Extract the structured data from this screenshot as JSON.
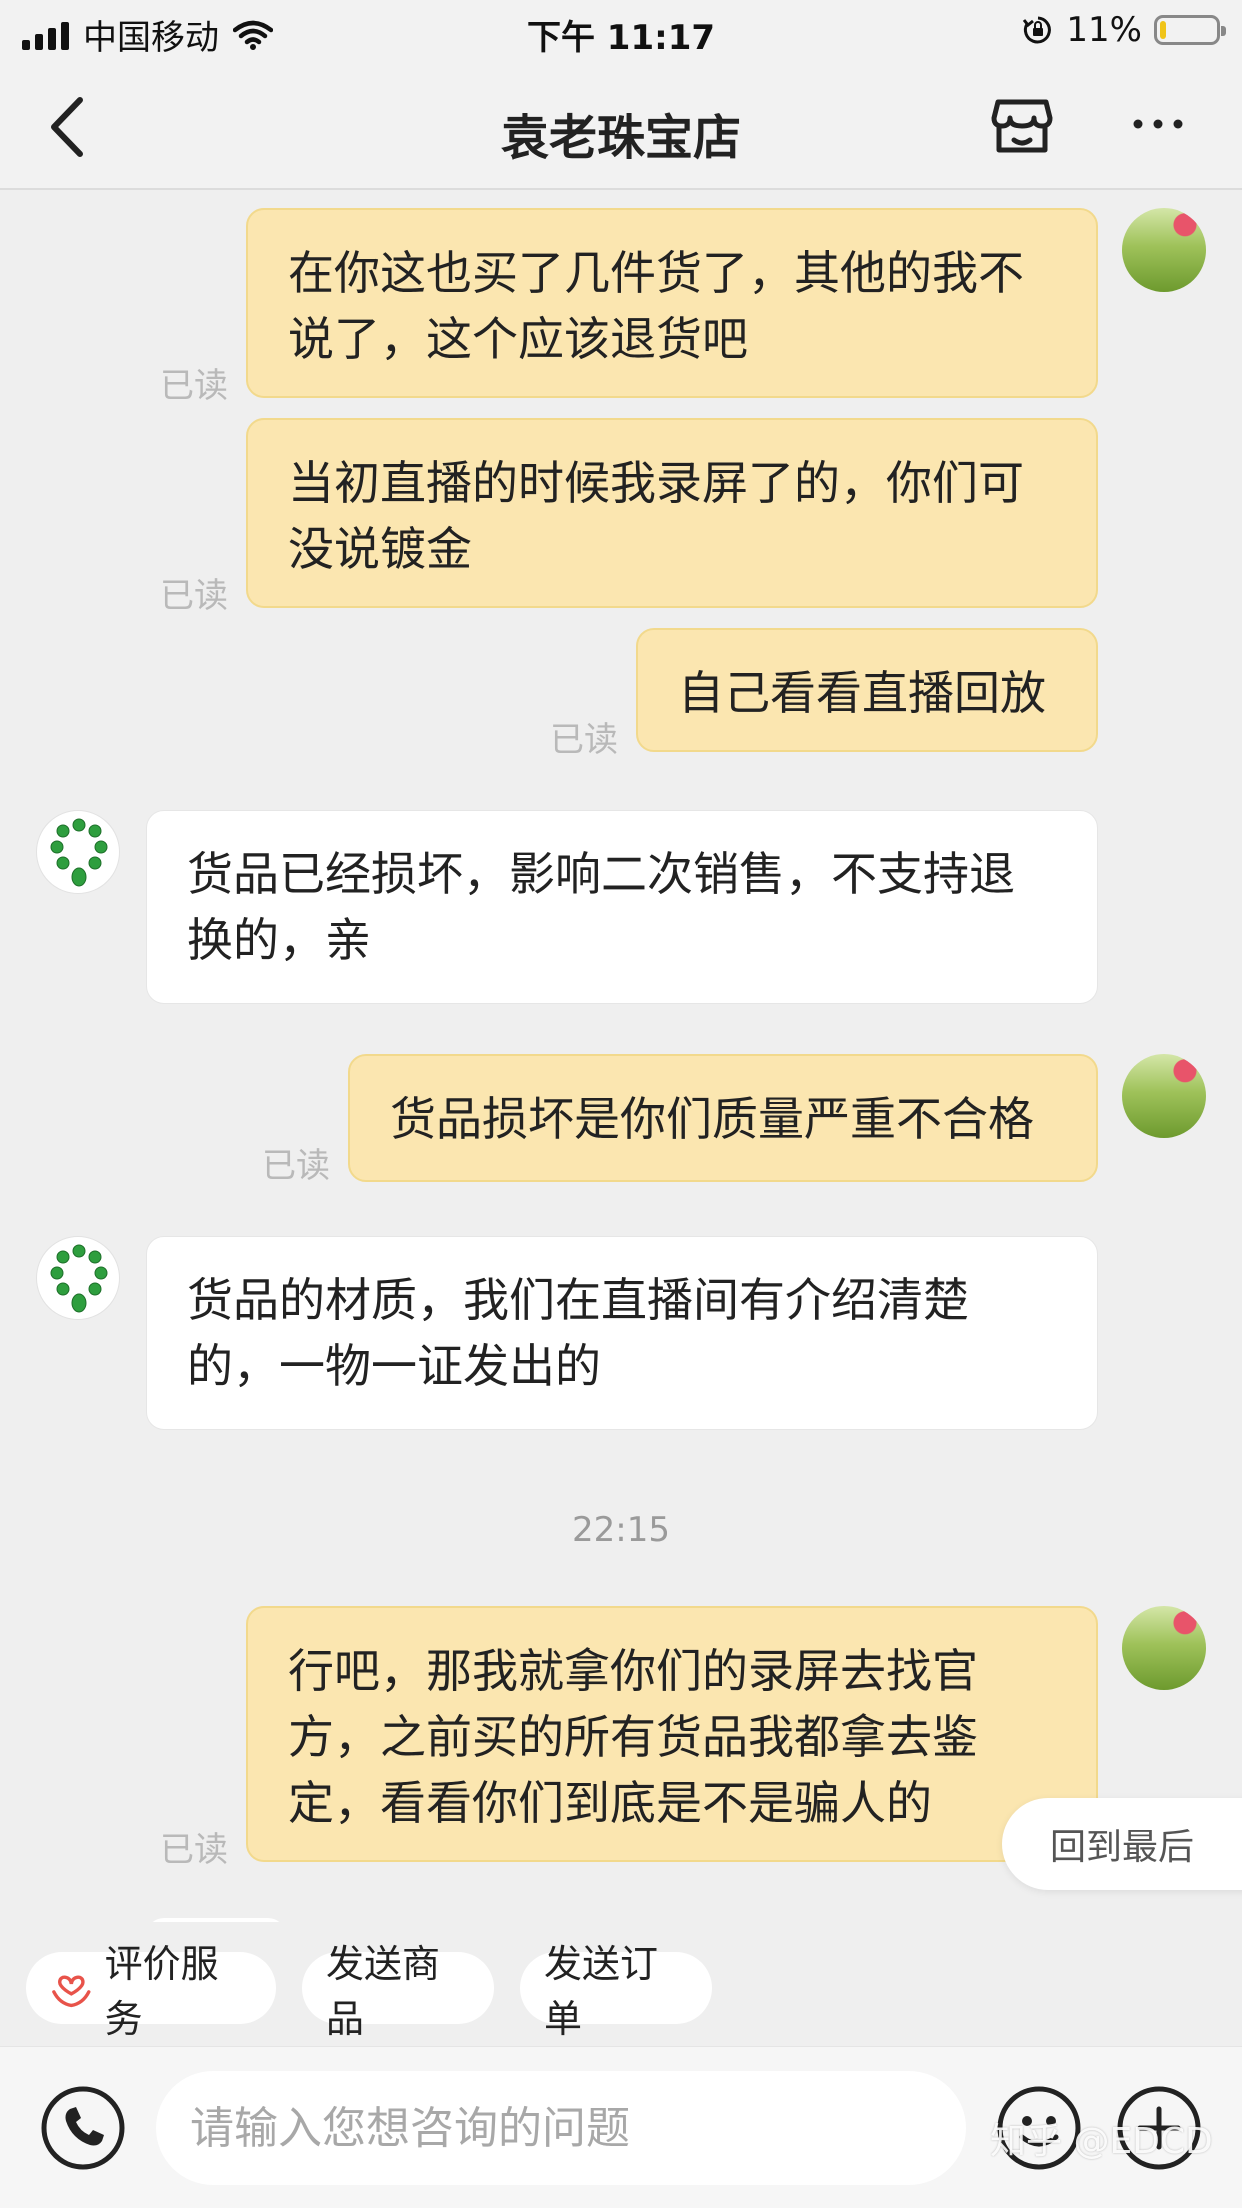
{
  "status_bar": {
    "carrier": "中国移动",
    "time": "下午 11:17",
    "battery_text": "11%",
    "battery_level": 0.11
  },
  "nav": {
    "title": "袁老珠宝店",
    "back_icon": "chevron-left-icon",
    "store_icon": "store-icon",
    "more_icon": "more-icon"
  },
  "messages": [
    {
      "side": "me",
      "lines": [
        "在你这也买了几件货了，其他的我不",
        "说了，这个应该退货吧"
      ],
      "read": "已读"
    },
    {
      "side": "me",
      "lines": [
        "当初直播的时候我录屏了的，你们可",
        "没说镀金"
      ],
      "read": "已读"
    },
    {
      "side": "me",
      "lines": [
        "自己看看直播回放"
      ],
      "read": "已读"
    },
    {
      "side": "them",
      "lines": [
        "货品已经损坏，影响二次销售，不支持退",
        "换的，亲"
      ]
    },
    {
      "side": "me",
      "lines": [
        "货品损坏是你们质量严重不合格"
      ],
      "read": "已读"
    },
    {
      "side": "them",
      "lines": [
        "货品的材质，我们在直播间有介绍清楚",
        "的，一物一证发出的"
      ]
    },
    {
      "side": "me",
      "lines": [
        "行吧，那我就拿你们的录屏去找官",
        "方，之前买的所有货品我都拿去鉴",
        "定，看看你们到底是不是骗人的"
      ],
      "read": "已读"
    }
  ],
  "timestamp": "22:15",
  "back_to_latest": "回到最后",
  "quick_actions": [
    {
      "label": "评价服务",
      "icon": "heart-hands-icon"
    },
    {
      "label": "发送商品"
    },
    {
      "label": "发送订单"
    }
  ],
  "input": {
    "placeholder": "请输入您想咨询的问题",
    "value": ""
  },
  "colors": {
    "my_bubble": "#fbe6b0",
    "their_bubble": "#ffffff",
    "background": "#efefef",
    "heart_icon": "#e8534a"
  },
  "watermark": "知乎 @EDCD"
}
